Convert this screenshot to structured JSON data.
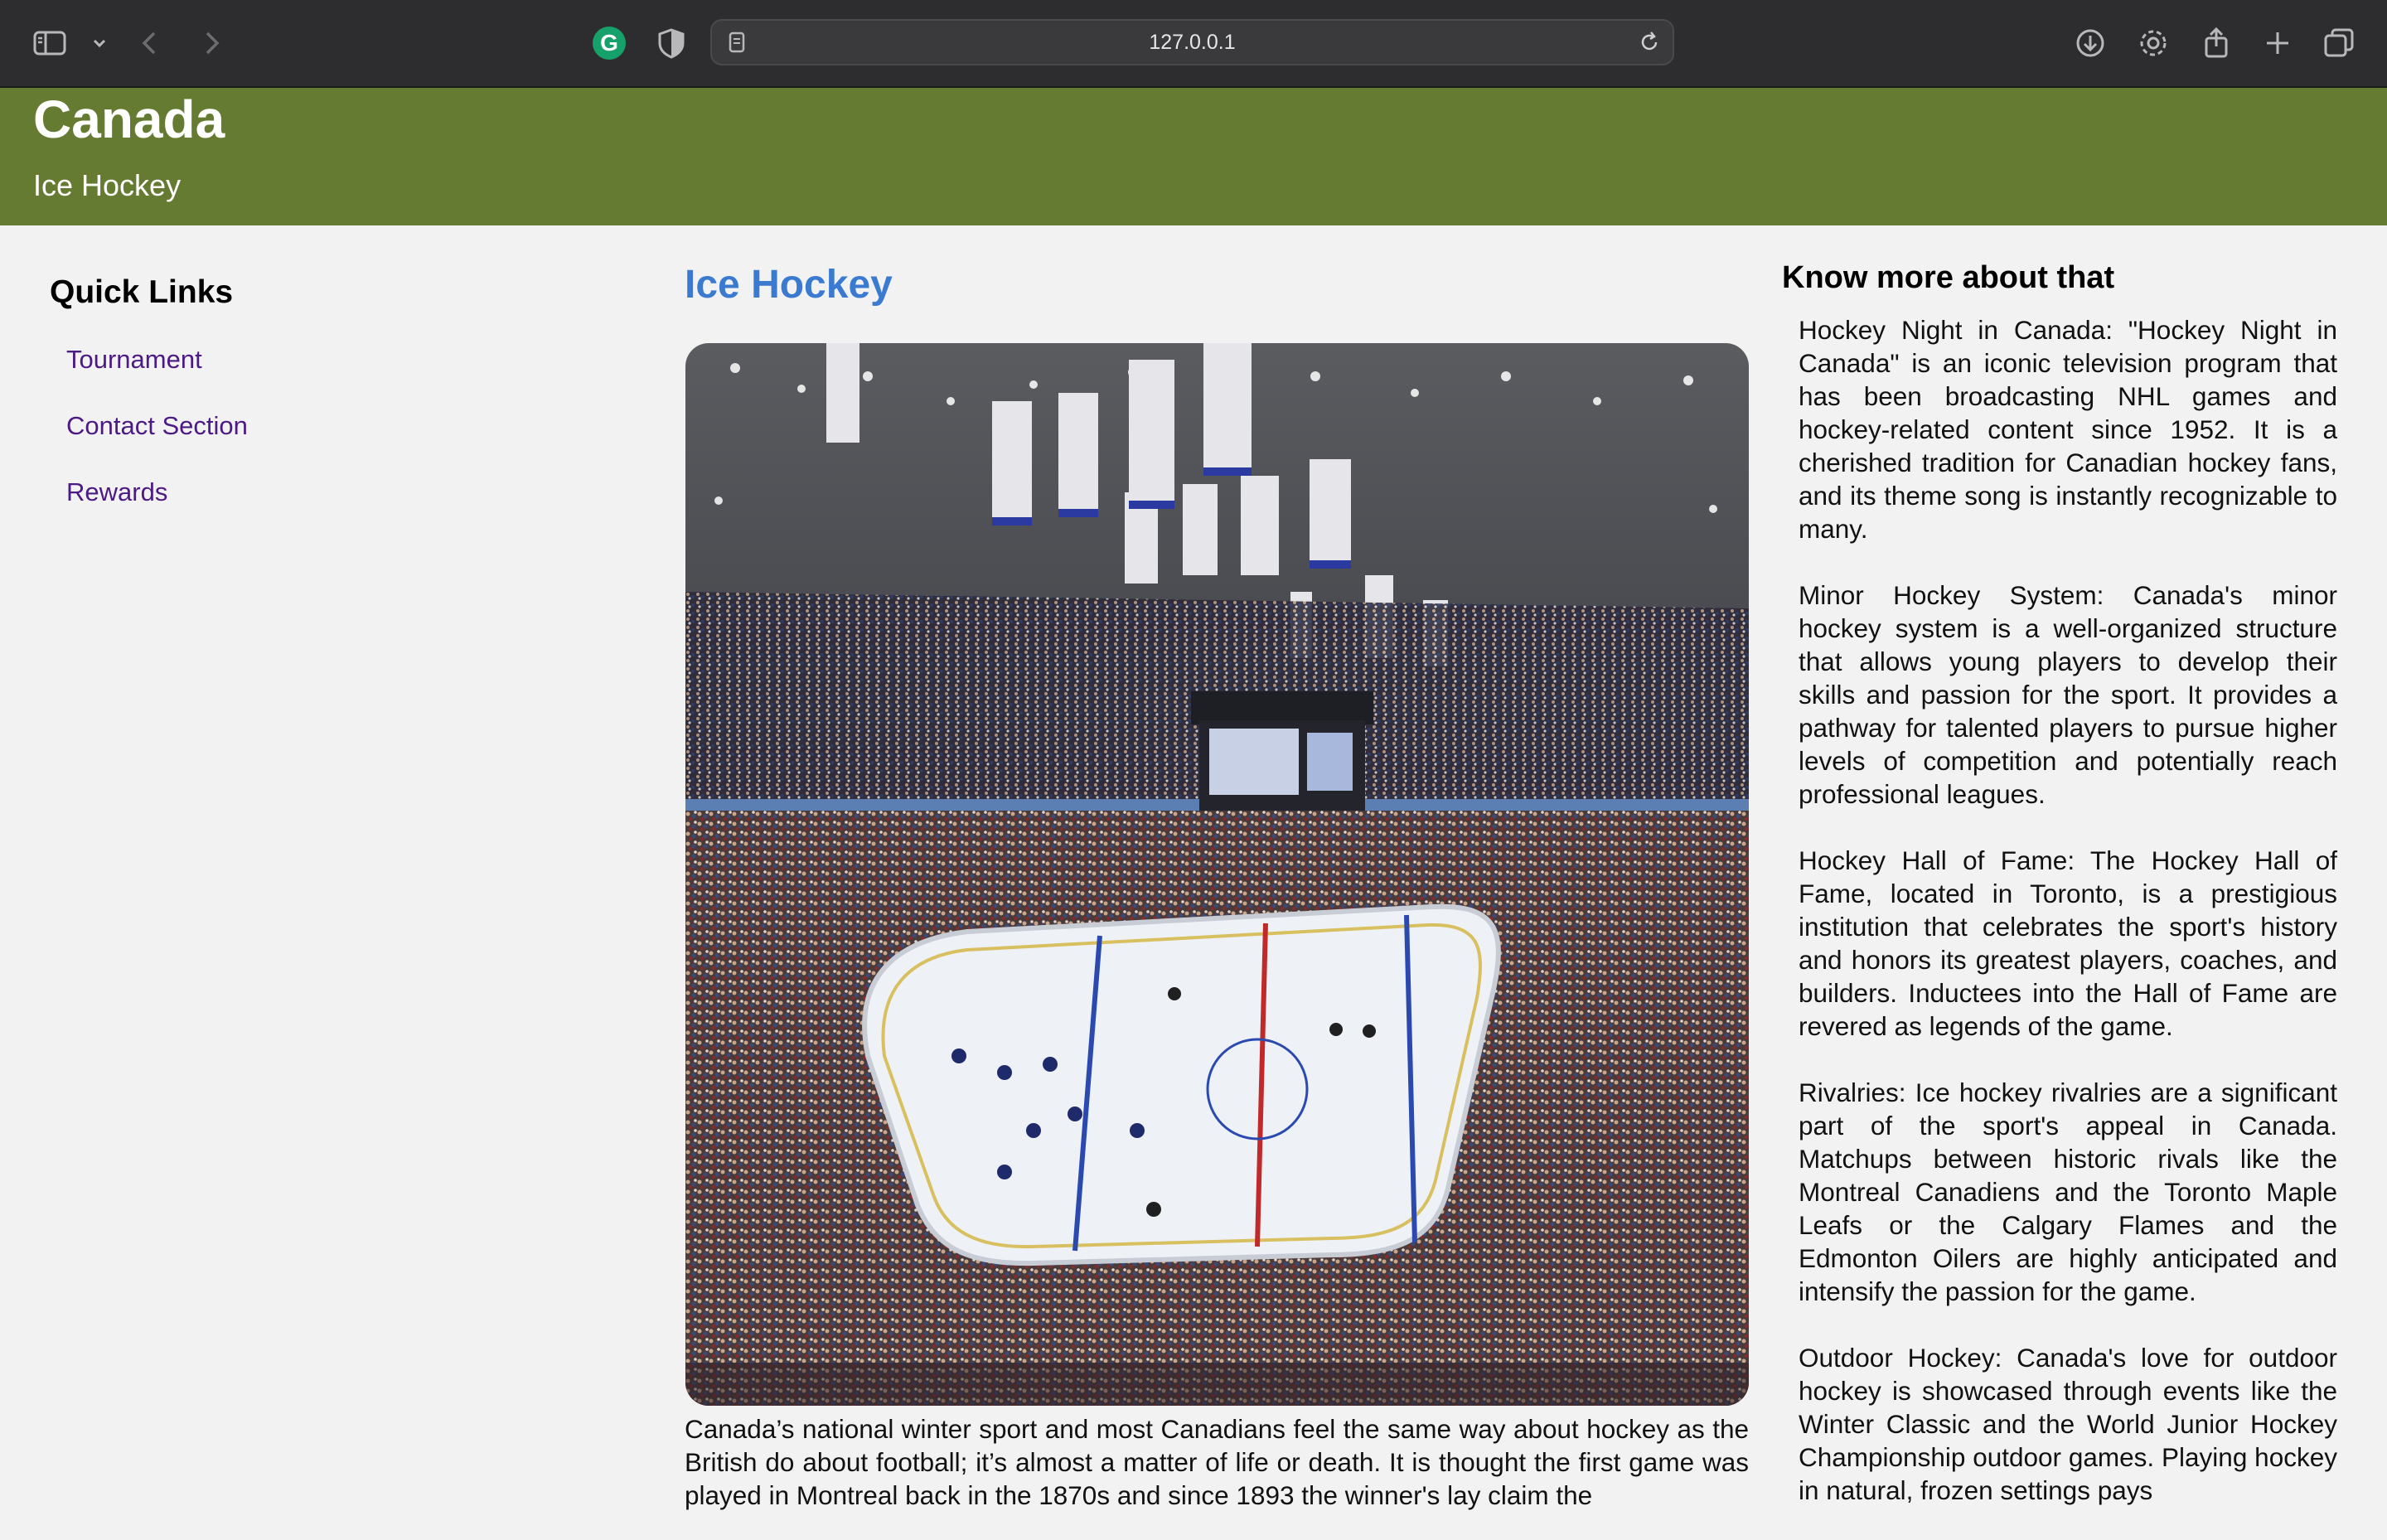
{
  "browser": {
    "url": "127.0.0.1",
    "icons": [
      "sidebar-toggle-icon",
      "chevron-down-icon",
      "back-arrow-icon",
      "forward-arrow-icon",
      "grammarly-icon",
      "privacy-shield-icon",
      "page-icon",
      "reload-icon",
      "download-icon",
      "settings-gear-icon",
      "share-icon",
      "new-tab-plus-icon",
      "tabs-overview-icon"
    ],
    "grammarly_letter": "G"
  },
  "header": {
    "title": "Canada",
    "subtitle": "Ice Hockey",
    "background": "#657b32"
  },
  "sidebar": {
    "heading": "Quick Links",
    "links": [
      {
        "label": "Tournament"
      },
      {
        "label": "Contact Section"
      },
      {
        "label": "Rewards"
      }
    ],
    "link_color": "#4c1a85"
  },
  "main": {
    "heading": "Ice Hockey",
    "heading_color": "#3a7ad0",
    "image_alt": "Ice hockey arena packed with fans",
    "body": "Canada’s national winter sport and most Canadians feel the same way about hockey as the British do about football; it’s almost a matter of life or death. It is thought the first game was played in Montreal back in the 1870s and since 1893 the winner's lay claim the"
  },
  "aside": {
    "heading": "Know more about that",
    "facts": [
      "Hockey Night in Canada: \"Hockey Night in Canada\" is an iconic television program that has been broadcasting NHL games and hockey-related content since 1952. It is a cherished tradition for Canadian hockey fans, and its theme song is instantly recognizable to many.",
      "Minor Hockey System: Canada's minor hockey system is a well-organized structure that allows young players to develop their skills and passion for the sport. It provides a pathway for talented players to pursue higher levels of competition and potentially reach professional leagues.",
      "Hockey Hall of Fame: The Hockey Hall of Fame, located in Toronto, is a prestigious institution that celebrates the sport's history and honors its greatest players, coaches, and builders. Inductees into the Hall of Fame are revered as legends of the game.",
      "Rivalries: Ice hockey rivalries are a significant part of the sport's appeal in Canada. Matchups between historic rivals like the Montreal Canadiens and the Toronto Maple Leafs or the Calgary Flames and the Edmonton Oilers are highly anticipated and intensify the passion for the game.",
      "Outdoor Hockey: Canada's love for outdoor hockey is showcased through events like the Winter Classic and the World Junior Hockey Championship outdoor games. Playing hockey in natural, frozen settings pays"
    ]
  }
}
